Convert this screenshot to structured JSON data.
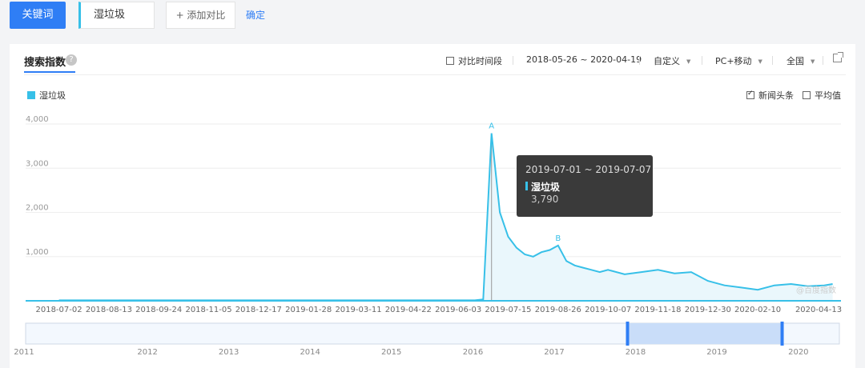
{
  "topbar": {
    "keyword_label": "关键词",
    "keyword_value": "湿垃圾",
    "add_compare_label": "+ 添加对比",
    "confirm_label": "确定"
  },
  "panel": {
    "title": "搜索指数",
    "help": "?",
    "compare_period_label": "对比时间段",
    "date_range": "2018-05-26 ~ 2020-04-19",
    "custom_label": "自定义",
    "device_label": "PC+移动",
    "region_label": "全国",
    "legend_label": "湿垃圾",
    "news_label": "新闻头条",
    "average_label": "平均值",
    "watermark": "@百度指数"
  },
  "tooltip": {
    "date": "2019-07-01 ~ 2019-07-07",
    "series": "湿垃圾",
    "value": "3,790"
  },
  "colors": {
    "accent": "#2f7ef5",
    "series": "#37c0e8",
    "fill": "#eaf7fc"
  },
  "chart_data": {
    "type": "area",
    "series": [
      {
        "name": "湿垃圾",
        "x": [
          "2018-07-02",
          "2018-08-13",
          "2018-09-24",
          "2018-11-05",
          "2018-12-17",
          "2019-01-28",
          "2019-03-11",
          "2019-04-22",
          "2019-06-03",
          "2019-06-17",
          "2019-06-24",
          "2019-07-01",
          "2019-07-08",
          "2019-07-15",
          "2019-07-22",
          "2019-07-29",
          "2019-08-05",
          "2019-08-12",
          "2019-08-19",
          "2019-08-26",
          "2019-09-02",
          "2019-09-09",
          "2019-09-16",
          "2019-09-23",
          "2019-09-30",
          "2019-10-07",
          "2019-10-21",
          "2019-11-04",
          "2019-11-18",
          "2019-12-02",
          "2019-12-16",
          "2019-12-30",
          "2020-01-13",
          "2020-01-27",
          "2020-02-10",
          "2020-02-24",
          "2020-03-09",
          "2020-03-23",
          "2020-04-06",
          "2020-04-13"
        ],
        "values": [
          10,
          10,
          10,
          10,
          10,
          10,
          10,
          10,
          10,
          10,
          30,
          3790,
          2000,
          1450,
          1200,
          1050,
          1000,
          1100,
          1150,
          1250,
          900,
          800,
          750,
          700,
          650,
          700,
          600,
          650,
          700,
          620,
          650,
          450,
          350,
          300,
          250,
          350,
          380,
          330,
          350,
          380
        ]
      }
    ],
    "xticks": [
      "2018-07-02",
      "2018-08-13",
      "2018-09-24",
      "2018-11-05",
      "2018-12-17",
      "2019-01-28",
      "2019-03-11",
      "2019-04-22",
      "2019-06-03",
      "2019-07-15",
      "2019-08-26",
      "2019-10-07",
      "2019-11-18",
      "2019-12-30",
      "2020-02-10",
      "2020-04-13"
    ],
    "yticks": [
      "4,000",
      "3,000",
      "2,000",
      "1,000"
    ],
    "ylim": [
      0,
      4000
    ],
    "annotations": [
      {
        "label": "A",
        "x": "2019-07-01",
        "y": 3790
      },
      {
        "label": "B",
        "x": "2019-08-26",
        "y": 1250
      }
    ],
    "grid": true,
    "legend": "top-left",
    "overview_years": [
      "2011",
      "2012",
      "2013",
      "2014",
      "2015",
      "2016",
      "2017",
      "2018",
      "2019",
      "2020"
    ],
    "overview_selection": [
      "2018-05-26",
      "2020-04-19"
    ]
  }
}
